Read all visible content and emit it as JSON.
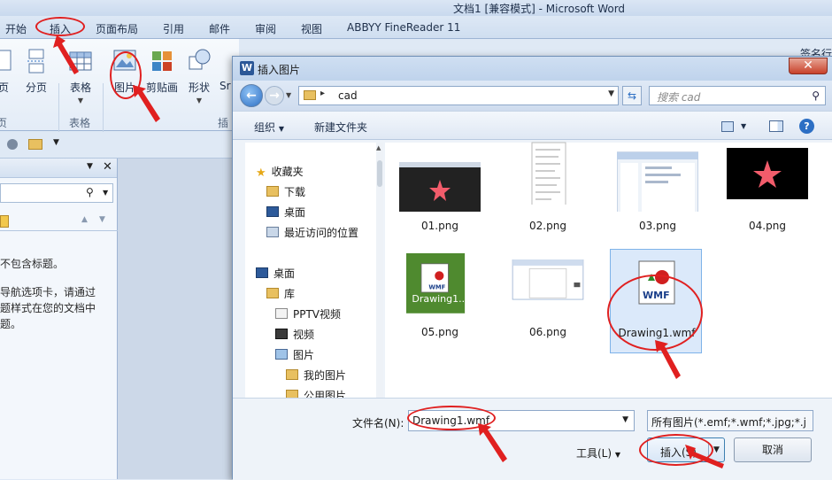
{
  "word": {
    "title": "文档1 [兼容模式] - Microsoft Word",
    "tabs": [
      "开始",
      "插入",
      "页面布局",
      "引用",
      "邮件",
      "审阅",
      "视图",
      "ABBYY FineReader 11"
    ],
    "ribbon": {
      "buttons": [
        "页",
        "分页",
        "表格",
        "图片",
        "剪贴画",
        "形状",
        "Sr"
      ],
      "groups": [
        "页",
        "表格",
        "插"
      ]
    },
    "nav_pane": {
      "lines": [
        "不包含标题。",
        "导航选项卡，请通过",
        "题样式在您的文档中",
        "题。"
      ]
    },
    "right_edge_text": "签名行"
  },
  "dialog": {
    "title": "插入图片",
    "address": {
      "path": "cad"
    },
    "search": {
      "placeholder": "搜索 cad"
    },
    "toolbar": {
      "organize": "组织",
      "new_folder": "新建文件夹"
    },
    "tree": [
      {
        "label": "收藏夹",
        "icon": "star-icon"
      },
      {
        "label": "下载",
        "icon": "download-folder-icon"
      },
      {
        "label": "桌面",
        "icon": "desktop-icon"
      },
      {
        "label": "最近访问的位置",
        "icon": "recent-places-icon"
      },
      {
        "label": "桌面",
        "icon": "desktop-icon"
      },
      {
        "label": "库",
        "icon": "library-icon"
      },
      {
        "label": "PPTV视频",
        "icon": "folder-icon"
      },
      {
        "label": "视频",
        "icon": "video-library-icon"
      },
      {
        "label": "图片",
        "icon": "picture-library-icon"
      },
      {
        "label": "我的图片",
        "icon": "folder-icon"
      },
      {
        "label": "公用图片",
        "icon": "folder-icon"
      }
    ],
    "files": [
      {
        "name": "01.png"
      },
      {
        "name": "02.png"
      },
      {
        "name": "03.png"
      },
      {
        "name": "04.png"
      },
      {
        "name": "05.png",
        "overlay": "Drawing1..."
      },
      {
        "name": "06.png"
      },
      {
        "name": "Drawing1.wmf",
        "selected": true,
        "icon_text": "WMF"
      }
    ],
    "filename": {
      "label": "文件名(N):",
      "value": "Drawing1.wmf"
    },
    "filetype": {
      "value": "所有图片(*.emf;*.wmf;*.jpg;*.j"
    },
    "tools_label": "工具(L)",
    "insert_label": "插入(S)",
    "cancel_label": "取消"
  },
  "colors": {
    "accent": "#3c7fb1",
    "annotation": "#e02020",
    "selection": "#dbe9fa"
  }
}
